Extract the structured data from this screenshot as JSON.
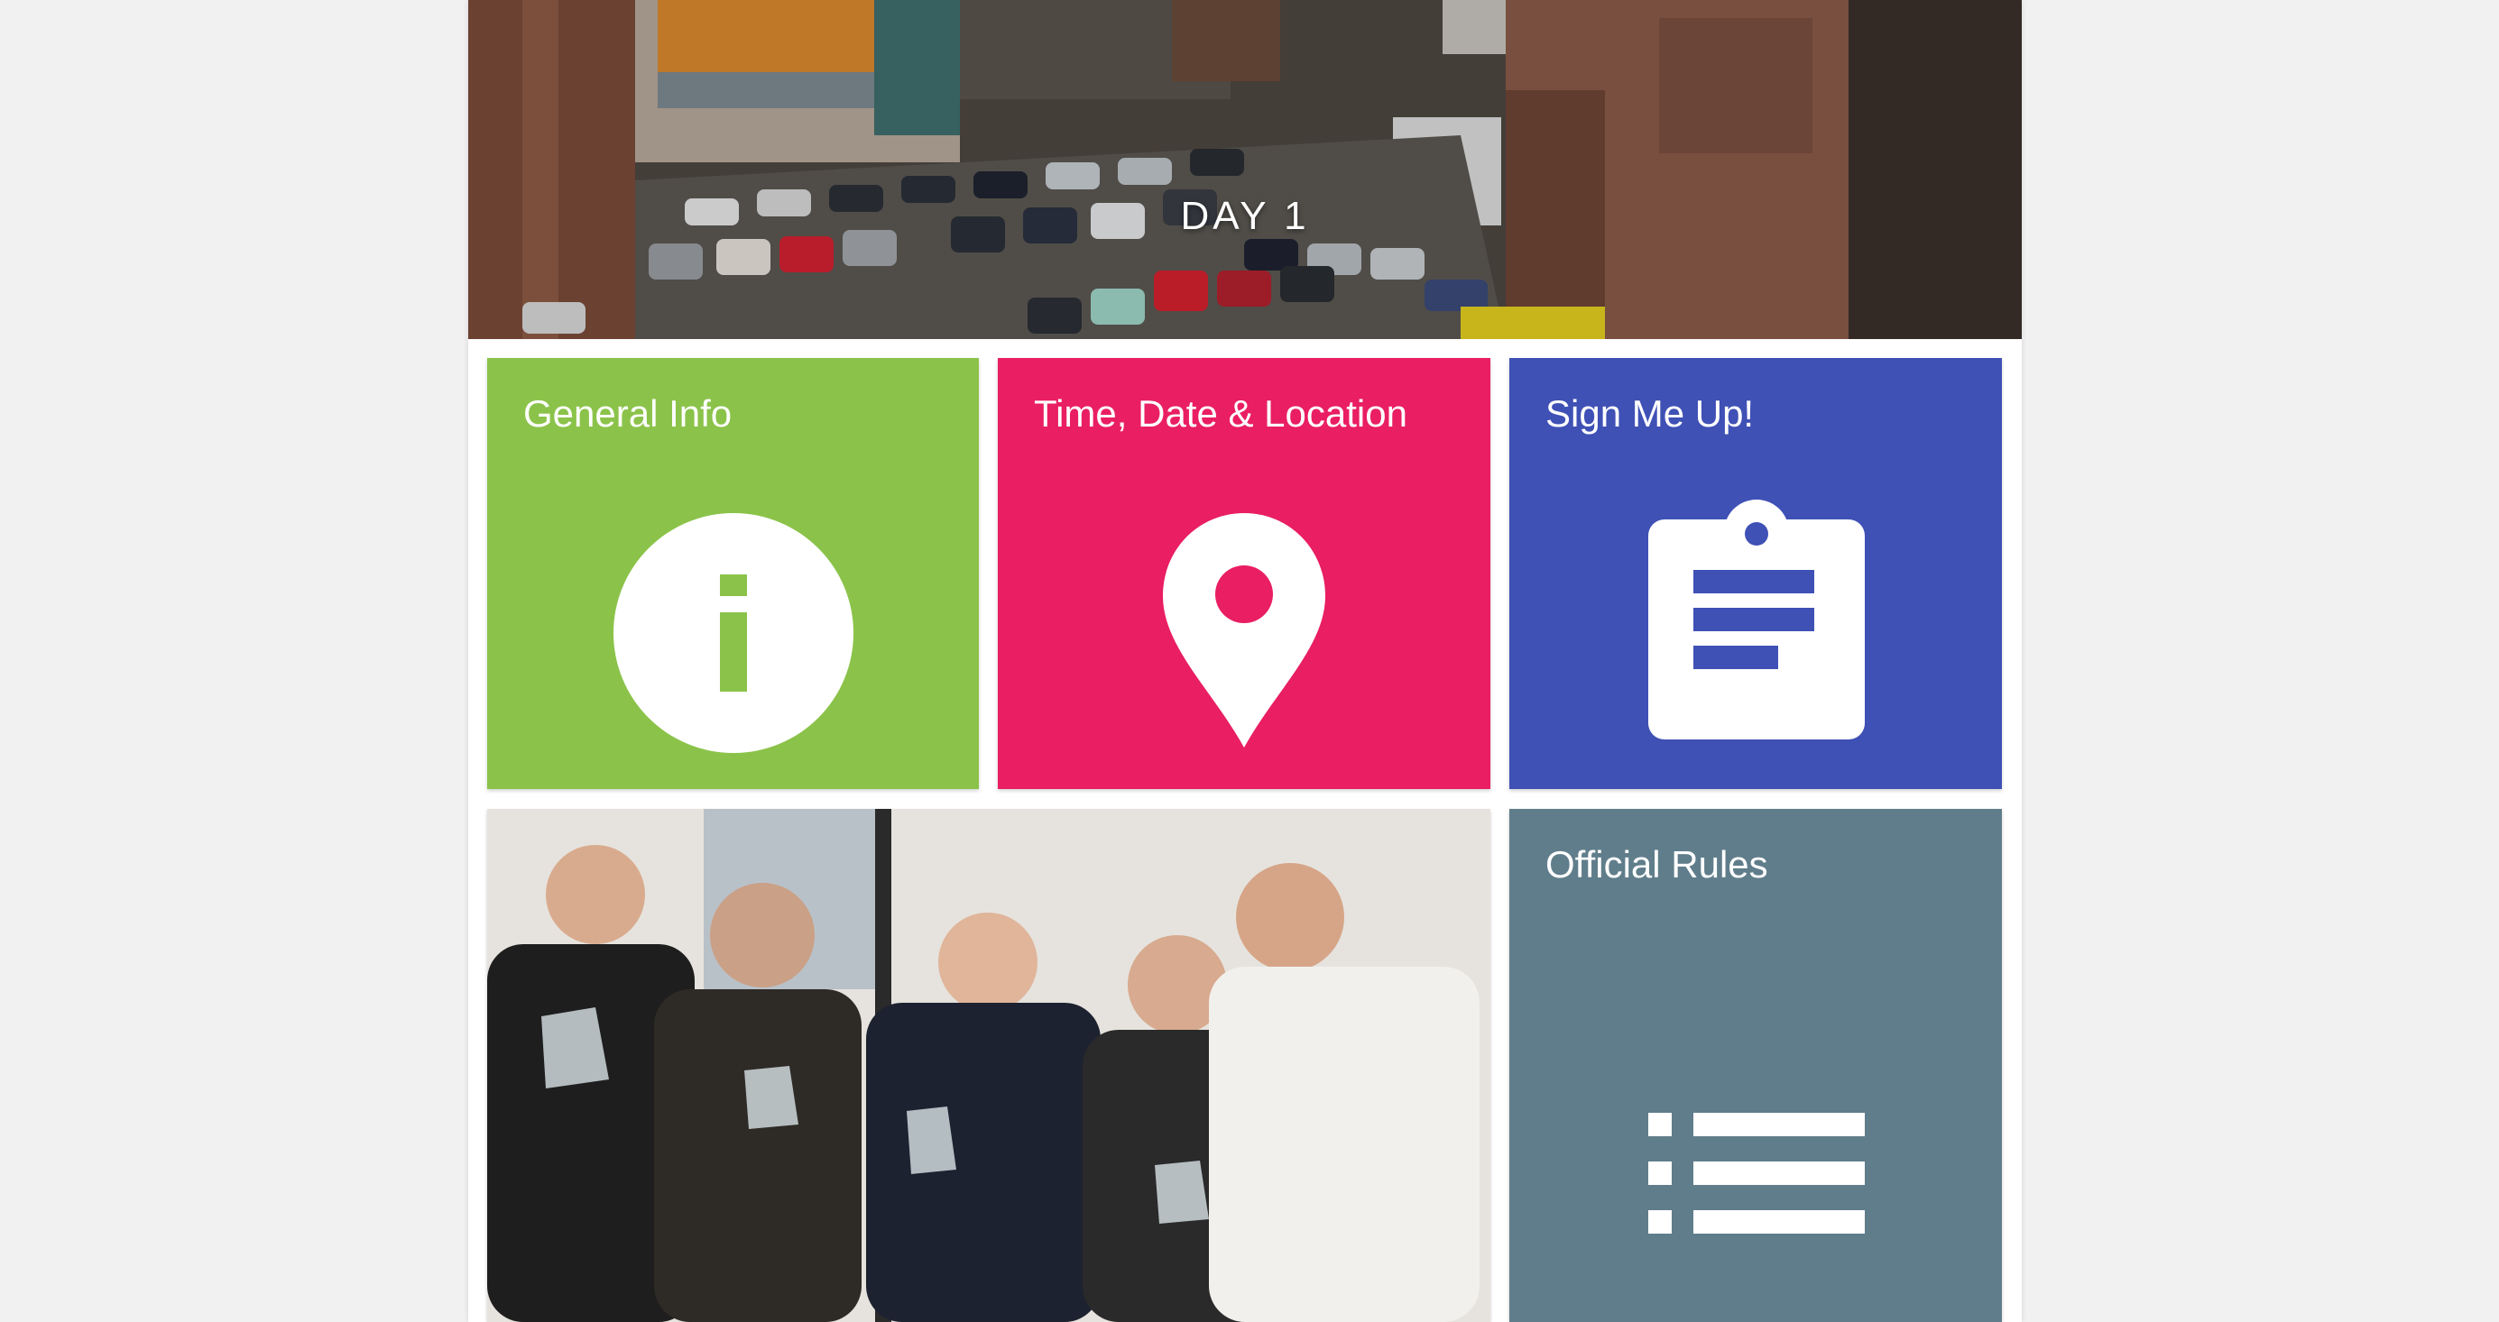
{
  "hero": {
    "title": "DAY 1",
    "image_description_icon": "city-parking-lot-photo"
  },
  "tiles": [
    {
      "label": "General Info",
      "icon": "info-icon",
      "color": "#8bc34a"
    },
    {
      "label": "Time, Date & Location",
      "icon": "location-pin-icon",
      "color": "#e91e63"
    },
    {
      "label": "Sign Me Up!",
      "icon": "clipboard-icon",
      "color": "#3f51b5"
    },
    {
      "label": "",
      "icon": "team-photo",
      "color": "#d9d6d1"
    },
    {
      "label": "Official Rules",
      "icon": "list-icon",
      "color": "#607d8b"
    }
  ],
  "colors": {
    "page_background": "#f1f1f1",
    "content_background": "#ffffff",
    "green": "#8bc34a",
    "pink": "#e91e63",
    "indigo": "#3f51b5",
    "blue_grey": "#607d8b"
  }
}
